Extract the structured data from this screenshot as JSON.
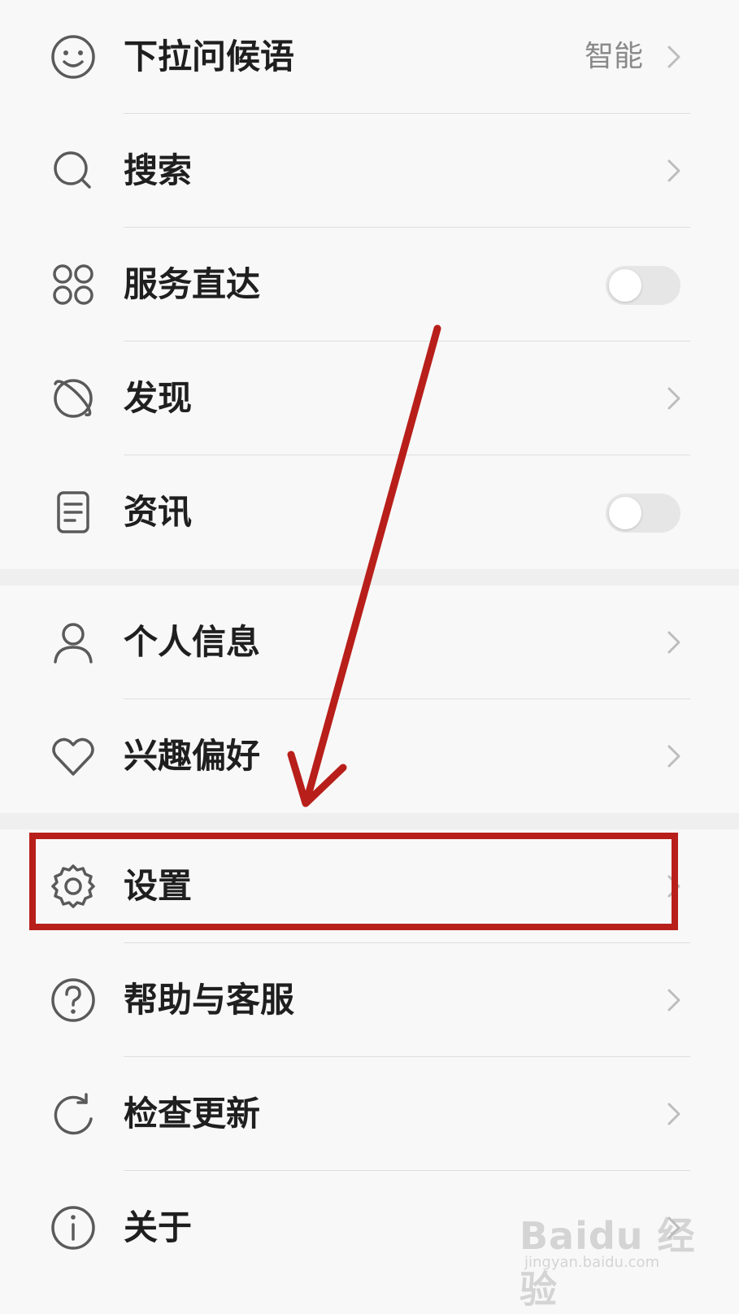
{
  "settings_list": {
    "items": [
      {
        "label": "下拉问候语",
        "value": "智能",
        "icon": "smiley-icon",
        "control": "chevron"
      },
      {
        "label": "搜索",
        "icon": "search-icon",
        "control": "chevron"
      },
      {
        "label": "服务直达",
        "icon": "grid-four-circles-icon",
        "control": "toggle",
        "toggle_on": false
      },
      {
        "label": "发现",
        "icon": "planet-icon",
        "control": "chevron"
      },
      {
        "label": "资讯",
        "icon": "document-icon",
        "control": "toggle",
        "toggle_on": false
      },
      {
        "label": "个人信息",
        "icon": "person-icon",
        "control": "chevron"
      },
      {
        "label": "兴趣偏好",
        "icon": "heart-icon",
        "control": "chevron"
      },
      {
        "label": "设置",
        "icon": "gear-icon",
        "control": "chevron"
      },
      {
        "label": "帮助与客服",
        "icon": "help-circle-icon",
        "control": "chevron"
      },
      {
        "label": "检查更新",
        "icon": "refresh-icon",
        "control": "chevron"
      },
      {
        "label": "关于",
        "icon": "info-icon",
        "control": "chevron"
      }
    ]
  },
  "annotation": {
    "highlight_target": "设置",
    "color": "#b81f1a"
  },
  "watermark": {
    "brand": "Baidu 经验",
    "site": "jingyan.baidu.com"
  },
  "colors": {
    "background": "#f8f8f8",
    "section_gap": "#efefef",
    "text": "#1f1f1f",
    "secondary_text": "#8a8a8a",
    "icon": "#5a5a5a",
    "toggle_off": "#e6e6e6"
  }
}
